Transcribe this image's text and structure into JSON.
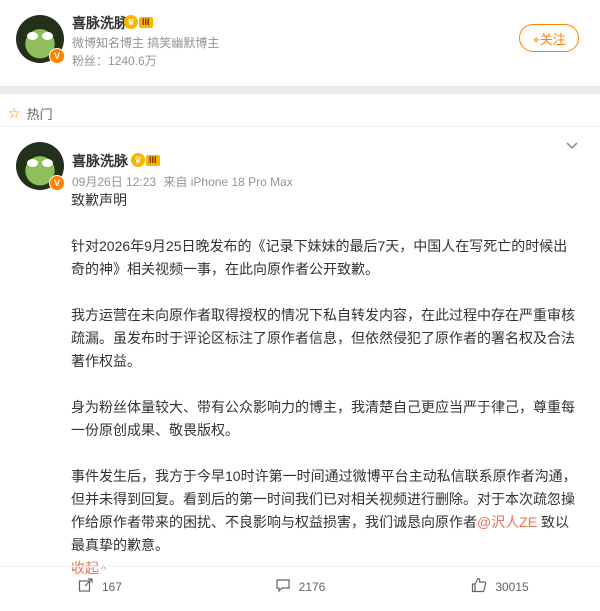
{
  "profile": {
    "name": "喜脉洗脉",
    "level": "III",
    "verified_glyph": "V",
    "desc": "微博知名博主 搞笑幽默博主",
    "followers_label": "粉丝：",
    "followers_value": "1240.6万",
    "follow_label": "+关注"
  },
  "section": {
    "title": "热门"
  },
  "post": {
    "author": "喜脉洗脉",
    "level": "III",
    "timestamp": "09月26日 12:23",
    "source": "来自 iPhone 18 Pro Max",
    "title_line": "致歉声明",
    "p1": "针对2026年9月25日晚发布的《记录下妹妹的最后7天，中国人在写死亡的时候出奇的神》相关视频一事，在此向原作者公开致歉。",
    "p2": "我方运营在未向原作者取得授权的情况下私自转发内容，在此过程中存在严重审核疏漏。虽发布时于评论区标注了原作者信息，但依然侵犯了原作者的署名权及合法著作权益。",
    "p3": "身为粉丝体量较大、带有公众影响力的博主，我清楚自己更应当严于律己，尊重每一份原创成果、敬畏版权。",
    "p4_a": "事件发生后，我方于今早10时许第一时间通过微博平台主动私信联系原作者沟通，但并未得到回复。看到后的第一时间我们已对相关视频进行删除。对于本次疏忽操作给原作者带来的困扰、不良影响与权益损害，我们诚恳向原作者",
    "mention": "@沢人ZE",
    "p4_b": " 致以最真挚的歉意。",
    "collapse_label": "收起",
    "collapse_glyph": "^"
  },
  "actions": {
    "share_count": "167",
    "comment_count": "2176",
    "like_count": "30015"
  },
  "icons": [
    "star-icon",
    "chevron-down-icon",
    "share-icon",
    "comment-icon",
    "like-icon",
    "verified-badge-icon",
    "level-crown-icon"
  ],
  "colors": {
    "accent": "#ff8200",
    "link": "#eb7350",
    "muted": "#939393"
  }
}
